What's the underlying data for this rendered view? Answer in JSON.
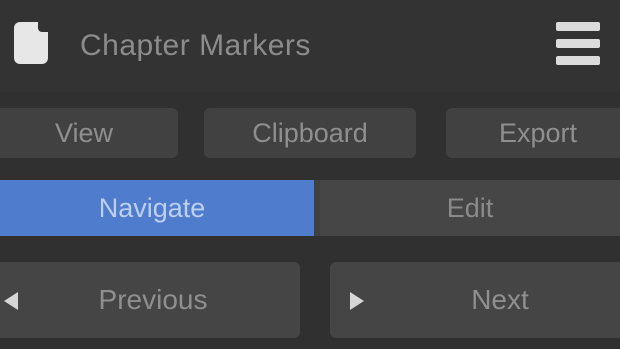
{
  "header": {
    "title": "Chapter Markers",
    "doc_icon": "document-icon",
    "menu_icon": "hamburger-menu-icon"
  },
  "toolbar": {
    "view_label": "View",
    "clipboard_label": "Clipboard",
    "export_label": "Export"
  },
  "mode": {
    "navigate_label": "Navigate",
    "edit_label": "Edit",
    "selected": "Navigate"
  },
  "navigation": {
    "previous_label": "Previous",
    "next_label": "Next",
    "previous_icon": "triangle-left-icon",
    "next_icon": "triangle-right-icon"
  },
  "colors": {
    "accent": "#4f7ccc",
    "background": "#303030",
    "button": "#414141"
  }
}
